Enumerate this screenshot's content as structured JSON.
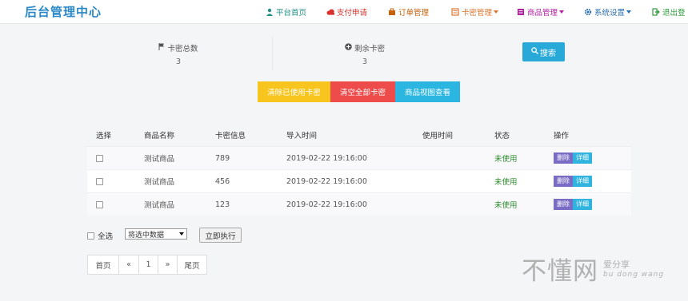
{
  "brand": "后台管理中心",
  "nav": {
    "items": [
      {
        "label": "平台首页",
        "icon": "user-icon",
        "color": "#1f8f86"
      },
      {
        "label": "支付申请",
        "icon": "cloud-icon",
        "color": "#d9312b"
      },
      {
        "label": "订单管理",
        "icon": "briefcase-icon",
        "color": "#c4620b"
      },
      {
        "label": "卡密管理",
        "icon": "card-icon",
        "color": "#e0762e"
      },
      {
        "label": "商品管理",
        "icon": "grid-icon",
        "color": "#b21fa3"
      },
      {
        "label": "系统设置",
        "icon": "gear-icon",
        "color": "#2b6fb0"
      },
      {
        "label": "退出登",
        "icon": "logout-icon",
        "color": "#2e9b3a"
      }
    ]
  },
  "stats": {
    "total_label": "卡密总数",
    "total_value": "3",
    "remaining_label": "剩余卡密",
    "remaining_value": "3"
  },
  "search_button": "搜索",
  "actions": {
    "clear_used": "清除已使用卡密",
    "clear_all": "清空全部卡密",
    "view_by_product": "商品视图查看"
  },
  "table": {
    "headers": [
      "选择",
      "商品名称",
      "卡密信息",
      "导入时间",
      "使用时间",
      "状态",
      "操作"
    ],
    "rows": [
      {
        "name": "测试商品",
        "card": "789",
        "imported": "2019-02-22 19:16:00",
        "used": "",
        "status": "未使用",
        "del": "删除",
        "detail": "详细"
      },
      {
        "name": "测试商品",
        "card": "456",
        "imported": "2019-02-22 19:16:00",
        "used": "",
        "status": "未使用",
        "del": "删除",
        "detail": "详细"
      },
      {
        "name": "测试商品",
        "card": "123",
        "imported": "2019-02-22 19:16:00",
        "used": "",
        "status": "未使用",
        "del": "删除",
        "detail": "详细"
      }
    ]
  },
  "bulk": {
    "select_all": "全选",
    "dropdown_value": "将选中数据",
    "execute": "立即执行"
  },
  "pager": {
    "first": "首页",
    "prev": "«",
    "current": "1",
    "next": "»",
    "last": "尾页"
  },
  "watermark": {
    "main": "不懂网",
    "cn": "爱分享",
    "en": "bu dong wang"
  },
  "colors": {
    "accent": "#2a88c8",
    "search": "#29a9d8",
    "clear_used": "#f7c51e",
    "clear_all": "#ee4b4b",
    "view_by_product": "#2ab6e0",
    "status_unused": "#2e8b2e"
  }
}
